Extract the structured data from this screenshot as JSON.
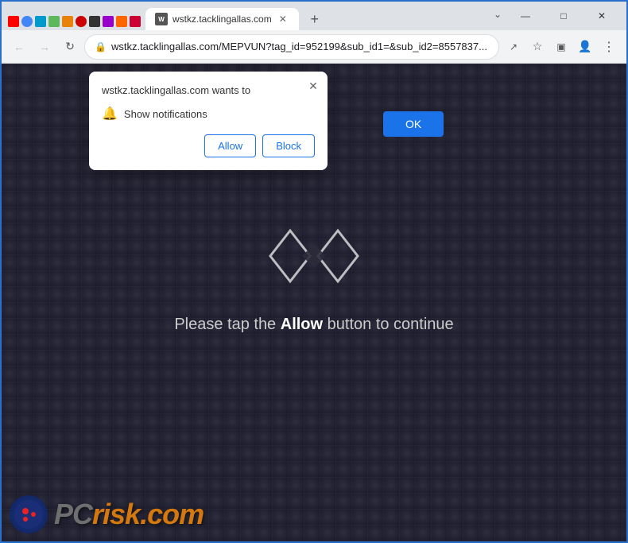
{
  "browser": {
    "title": "wstkz.tacklingallas.com",
    "url": "wstkz.tacklingallas.com/MEPVUN?tag_id=952199&sub_id1=&sub_id2=8557837...",
    "tab_label": "wstkz.tacklingallas.com"
  },
  "toolbar": {
    "back_label": "←",
    "forward_label": "→",
    "refresh_label": "↻",
    "new_tab_label": "+",
    "minimize_label": "—",
    "maximize_label": "□",
    "close_label": "✕"
  },
  "dialog": {
    "header": "wstkz.tacklingallas.com wants to",
    "permission_text": "Show notifications",
    "allow_label": "Allow",
    "block_label": "Block",
    "close_label": "✕",
    "ok_label": "OK"
  },
  "page": {
    "instruction_text_before": "Please tap the ",
    "instruction_text_bold": "Allow",
    "instruction_text_after": " button to continue"
  },
  "watermark": {
    "text_gray": "PC",
    "text_orange": "risk.com"
  }
}
